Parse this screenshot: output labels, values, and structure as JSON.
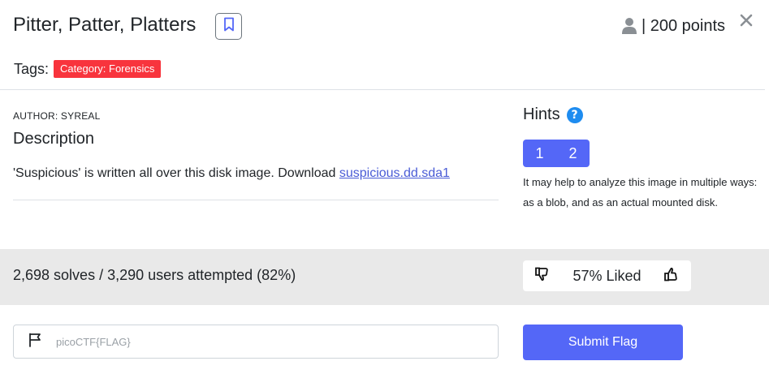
{
  "header": {
    "title": "Pitter, Patter, Platters",
    "points_text": "| 200 points"
  },
  "tags": {
    "label": "Tags:",
    "items": [
      "Category: Forensics"
    ]
  },
  "description": {
    "author": "AUTHOR: SYREAL",
    "heading": "Description",
    "text": "'Suspicious' is written all over this disk image. Download ",
    "link_text": "suspicious.dd.sda1"
  },
  "hints": {
    "heading": "Hints",
    "tabs": [
      "1",
      "2"
    ],
    "text": "It may help to analyze this image in multiple ways: as a blob, and as an actual mounted disk."
  },
  "stats": {
    "solves_text": "2,698 solves / 3,290 users attempted (82%)",
    "liked_text": "57% Liked"
  },
  "flag": {
    "placeholder": "picoCTF{FLAG}",
    "value": "",
    "submit_label": "Submit Flag"
  },
  "colors": {
    "accent": "#5467f7",
    "tag": "#f8343d",
    "help": "#1e8cf0",
    "stats_bg": "#e9e9e9"
  }
}
